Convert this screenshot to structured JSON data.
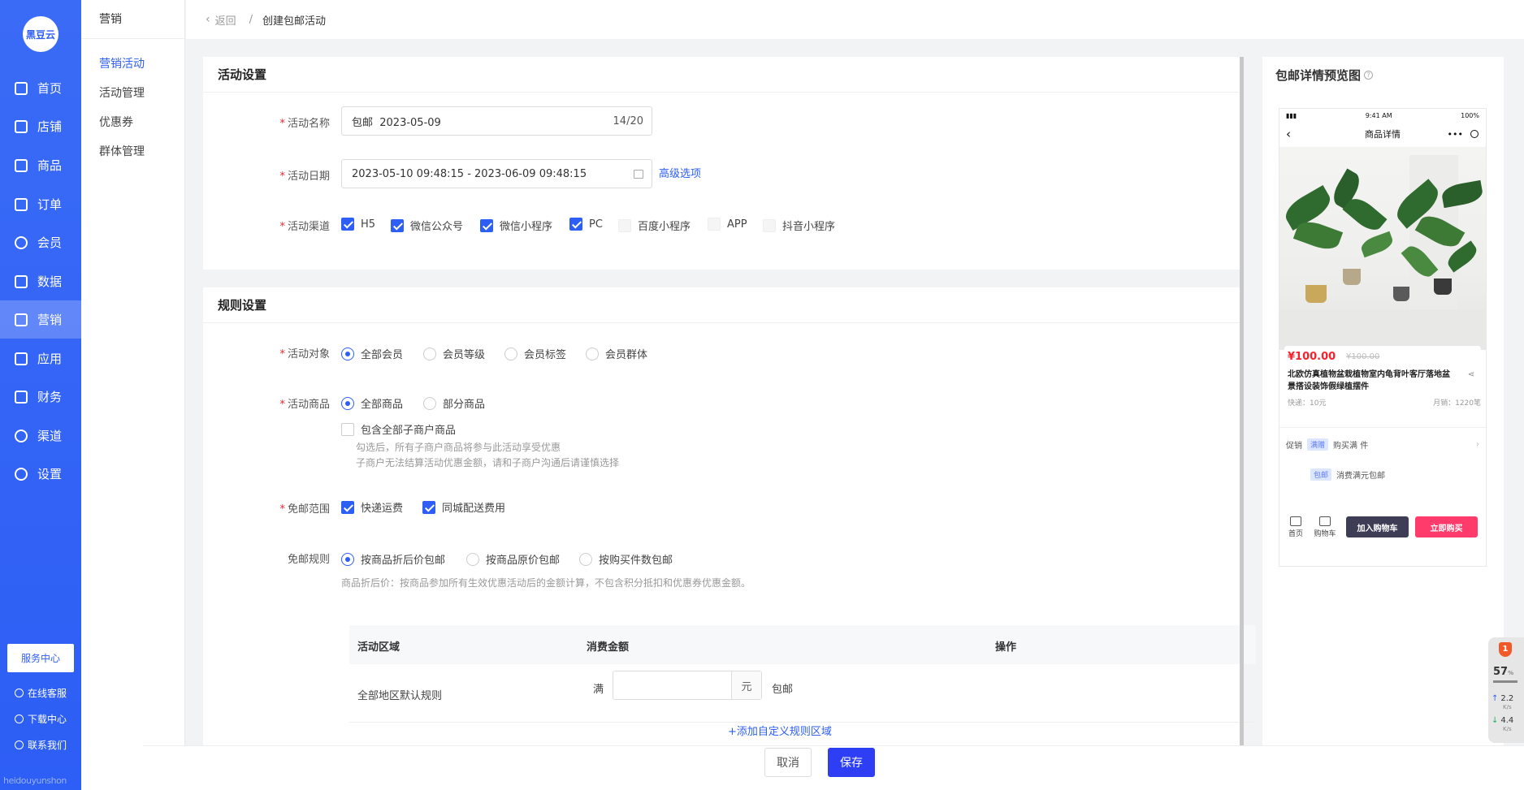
{
  "sidebar": {
    "logo": "黑豆云",
    "items": [
      {
        "label": "首页",
        "icon": "home-icon"
      },
      {
        "label": "店铺",
        "icon": "shop-icon"
      },
      {
        "label": "商品",
        "icon": "goods-icon"
      },
      {
        "label": "订单",
        "icon": "order-icon"
      },
      {
        "label": "会员",
        "icon": "user-icon"
      },
      {
        "label": "数据",
        "icon": "chart-icon"
      },
      {
        "label": "营销",
        "icon": "tag-icon"
      },
      {
        "label": "应用",
        "icon": "app-icon"
      },
      {
        "label": "财务",
        "icon": "finance-icon"
      },
      {
        "label": "渠道",
        "icon": "channel-icon"
      },
      {
        "label": "设置",
        "icon": "gear-icon"
      }
    ],
    "service_center": "服务中心",
    "links": [
      "在线客服",
      "下载中心",
      "联系我们"
    ],
    "watermark": "heidouyunshon"
  },
  "subnav": {
    "title": "营销",
    "items": [
      "营销活动",
      "活动管理",
      "优惠券",
      "群体管理"
    ]
  },
  "breadcrumb": {
    "back": "返回",
    "sep": "/",
    "current": "创建包邮活动"
  },
  "activity": {
    "title": "活动设置",
    "name_label": "活动名称",
    "name_value": "包邮  2023-05-09",
    "name_count": "14/20",
    "date_label": "活动日期",
    "date_value": "2023-05-10 09:48:15 - 2023-06-09 09:48:15",
    "advanced": "高级选项",
    "channel_label": "活动渠道",
    "channels": [
      {
        "label": "H5",
        "checked": true
      },
      {
        "label": "微信公众号",
        "checked": true
      },
      {
        "label": "微信小程序",
        "checked": true
      },
      {
        "label": "PC",
        "checked": true
      },
      {
        "label": "百度小程序",
        "checked": false
      },
      {
        "label": "APP",
        "checked": false
      },
      {
        "label": "抖音小程序",
        "checked": false
      }
    ]
  },
  "rules": {
    "title": "规则设置",
    "target_label": "活动对象",
    "targets": [
      "全部会员",
      "会员等级",
      "会员标签",
      "会员群体"
    ],
    "goods_label": "活动商品",
    "goods": [
      "全部商品",
      "部分商品"
    ],
    "sub_merchant": "包含全部子商户商品",
    "sub_hint1": "勾选后，所有子商户商品将参与此活动享受优惠",
    "sub_hint2": "子商户无法结算活动优惠金额，请和子商户沟通后请谨慎选择",
    "scope_label": "免邮范围",
    "scopes": [
      "快递运费",
      "同城配送费用"
    ],
    "rule_label": "免邮规则",
    "rule_options": [
      "按商品折后价包邮",
      "按商品原价包邮",
      "按购买件数包邮"
    ],
    "rule_hint": "商品折后价：按商品参加所有生效优惠活动后的金额计算，不包含积分抵扣和优惠券优惠金额。",
    "table_headers": [
      "活动区域",
      "消费金额",
      "操作"
    ],
    "row_region": "全部地区默认规则",
    "row_full": "满",
    "row_unit": "元",
    "row_free": "包邮",
    "add_rule": "+添加自定义规则区域"
  },
  "footer": {
    "cancel": "取消",
    "save": "保存"
  },
  "preview": {
    "title": "包邮详情预览图",
    "status_time": "9:41 AM",
    "status_battery": "100%",
    "nav_title": "商品详情",
    "price": "¥100.00",
    "old_price": "¥100.00",
    "product_name": "北欧仿真植物盆栽植物室内龟背叶客厅落地盆景搭设装饰假绿植摆件",
    "shipping": "快递：10元",
    "sales": "月销：1220笔",
    "promo_label": "促销",
    "promo_tag1": "满赠",
    "promo_text1": "购买满 件",
    "promo_tag2": "包邮",
    "promo_text2": "消费满元包邮",
    "bottom_home": "首页",
    "bottom_cart": "购物车",
    "add_cart": "加入购物车",
    "buy_now": "立即购买"
  },
  "widget": {
    "badge": "1",
    "percent": "57",
    "up": "2.2",
    "down": "4.4",
    "unit": "K/s"
  },
  "colors": {
    "primary": "#2d5ef5",
    "red": "#f5222d",
    "buy": "#ff3b6b",
    "cart": "#3d3d55"
  }
}
